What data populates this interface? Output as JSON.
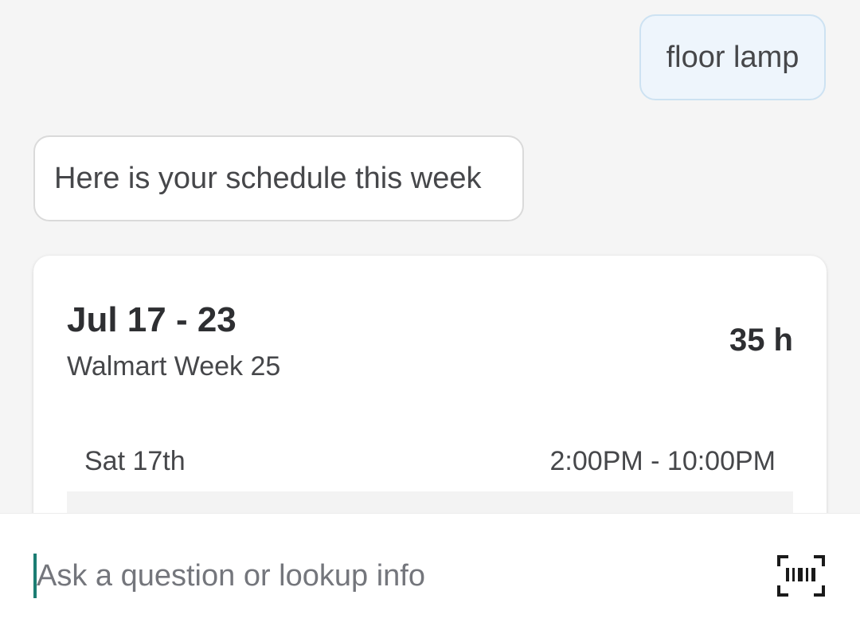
{
  "messages": {
    "user_query": "floor lamp",
    "bot_reply": "Here is your schedule this week"
  },
  "schedule_card": {
    "date_range": "Jul 17 - 23",
    "week_label": "Walmart Week 25",
    "total_hours": "35 h",
    "shifts": [
      {
        "day": "Sat 17th",
        "time": "2:00PM - 10:00PM"
      }
    ]
  },
  "input": {
    "placeholder": "Ask a question or lookup info",
    "value": ""
  },
  "icons": {
    "scan": "barcode-scan-icon"
  },
  "colors": {
    "background": "#f5f5f5",
    "user_bubble": "#eef5fc",
    "cursor_accent": "#1b7d73"
  }
}
